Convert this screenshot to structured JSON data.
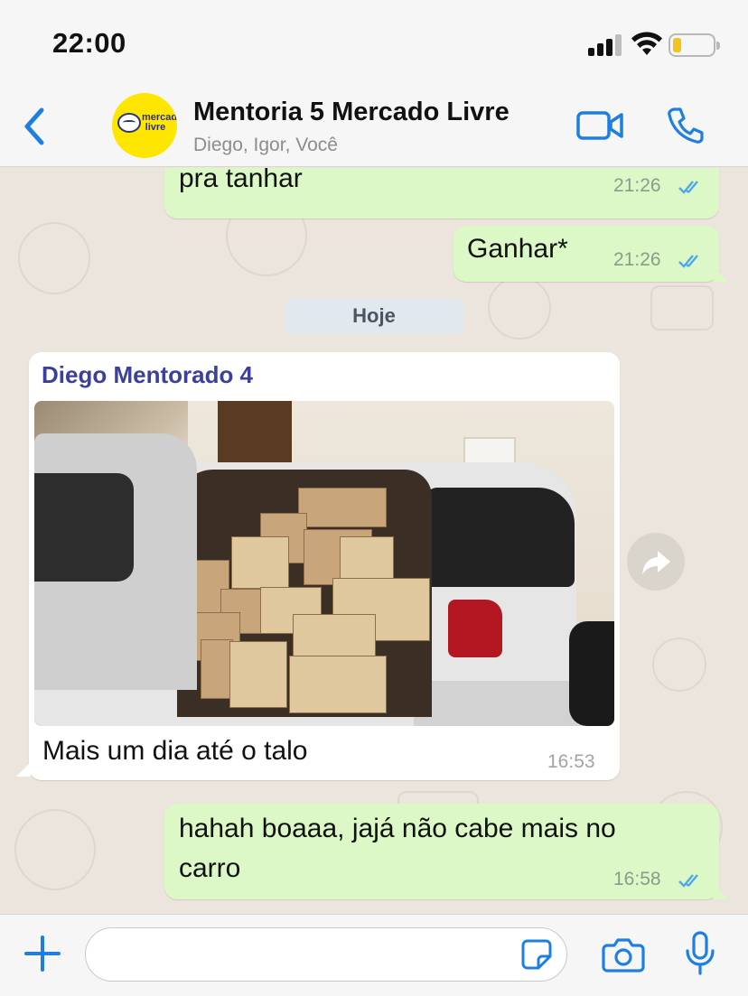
{
  "status_bar": {
    "time": "22:00"
  },
  "header": {
    "title": "Mentoria 5 Mercado Livre",
    "subtitle": "Diego, Igor, Você",
    "avatar_logo_text": "mercado livre",
    "brand_color": "#FFE600",
    "accent_color": "#1F7FE0",
    "icons": [
      "back-chevron-icon",
      "video-call-icon",
      "phone-call-icon"
    ]
  },
  "messages": [
    {
      "direction": "out",
      "text": "pra tanhar",
      "time": "21:26",
      "status": "read"
    },
    {
      "direction": "out",
      "text": "Ganhar*",
      "time": "21:26",
      "status": "read"
    }
  ],
  "day_separator": "Hoje",
  "media_message": {
    "sender": "Diego Mentorado 4",
    "sender_color": "#3B3F9E",
    "caption": "Mais um dia até o talo",
    "time": "16:53",
    "image_description_icon": "photo-car-trunk-full-of-boxes"
  },
  "last_message": {
    "direction": "out",
    "text": "hahah boaaa, jajá não cabe mais no carro",
    "time": "16:58",
    "status": "read"
  },
  "composer": {
    "placeholder": "",
    "icons": [
      "plus-icon",
      "sticker-icon",
      "camera-icon",
      "microphone-icon"
    ]
  },
  "colors": {
    "outgoing_bubble": "#DCF8C6",
    "incoming_bubble": "#FFFFFF",
    "chat_background": "#ECE5DD",
    "read_ticks": "#4FA8E8"
  }
}
